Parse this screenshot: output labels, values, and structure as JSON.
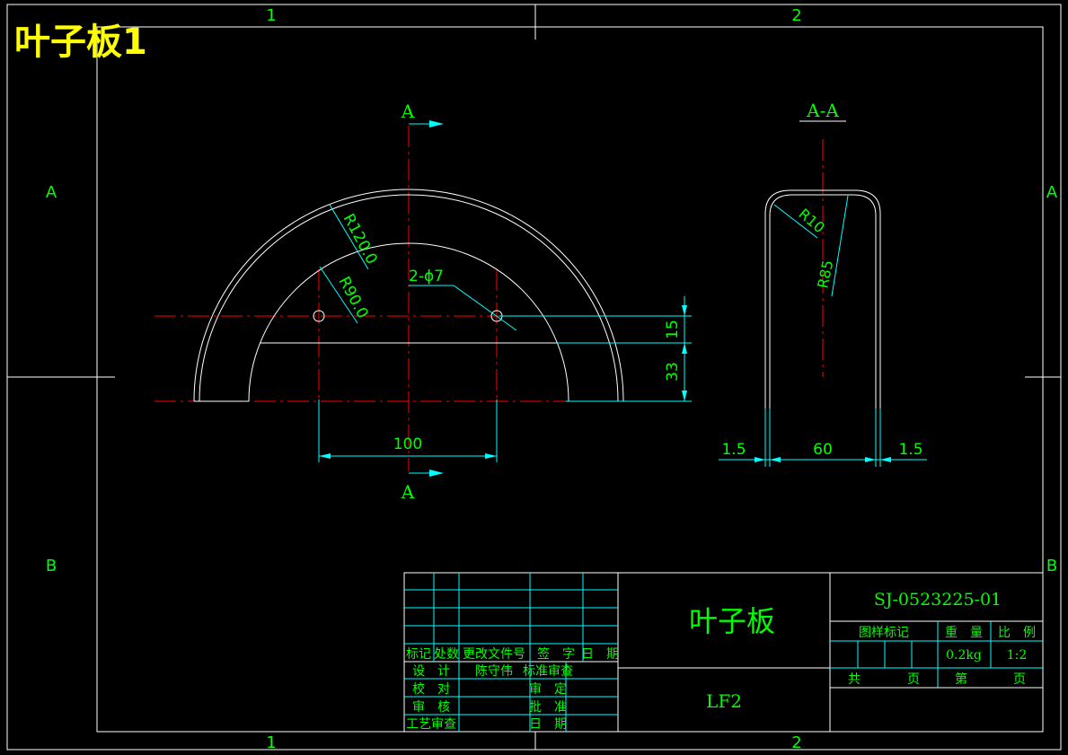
{
  "sheet_title": "叶子板1",
  "zones": {
    "top_1": "1",
    "top_2": "2",
    "bottom_1": "1",
    "bottom_2": "2",
    "left_A": "A",
    "left_B": "B",
    "right_A": "A",
    "right_B": "B"
  },
  "front_view": {
    "section_mark_top": "A",
    "section_mark_bottom": "A",
    "radius_outer": "R120.0",
    "radius_inner": "R90.0",
    "hole_callout": "2-ϕ7",
    "dim_width": "100",
    "dim_15": "15",
    "dim_33": "33"
  },
  "section_view": {
    "label": "A-A",
    "radius_small": "R10",
    "radius_large": "R85",
    "dim_left": "1.5",
    "dim_mid": "60",
    "dim_right": "1.5"
  },
  "title_block": {
    "part_name": "叶子板",
    "material": "LF2",
    "drawing_no": "SJ-0523225-01",
    "hdr_mark": "图样标记",
    "hdr_weight": "重　量",
    "hdr_scale": "比　例",
    "weight": "0.2kg",
    "scale": "1:2",
    "total_label": "共",
    "page_label1": "页",
    "sheet_label": "第",
    "page_label2": "页",
    "rev_headers": [
      "标记",
      "处数",
      "更改文件号",
      "签　字",
      "日　期"
    ],
    "row_design": "设　计",
    "designer": "陈守伟",
    "std_review": "标准审查",
    "row_check": "校　对",
    "approve_label": "审　定",
    "row_review": "审　核",
    "ratify_label": "批　准",
    "row_process": "工艺审查",
    "date_label": "日　期"
  },
  "colors": {
    "frame": "#ffffff",
    "green": "#00ff00",
    "cyan": "#00ffff",
    "red": "#ff0000",
    "yellow": "#ffff00"
  }
}
